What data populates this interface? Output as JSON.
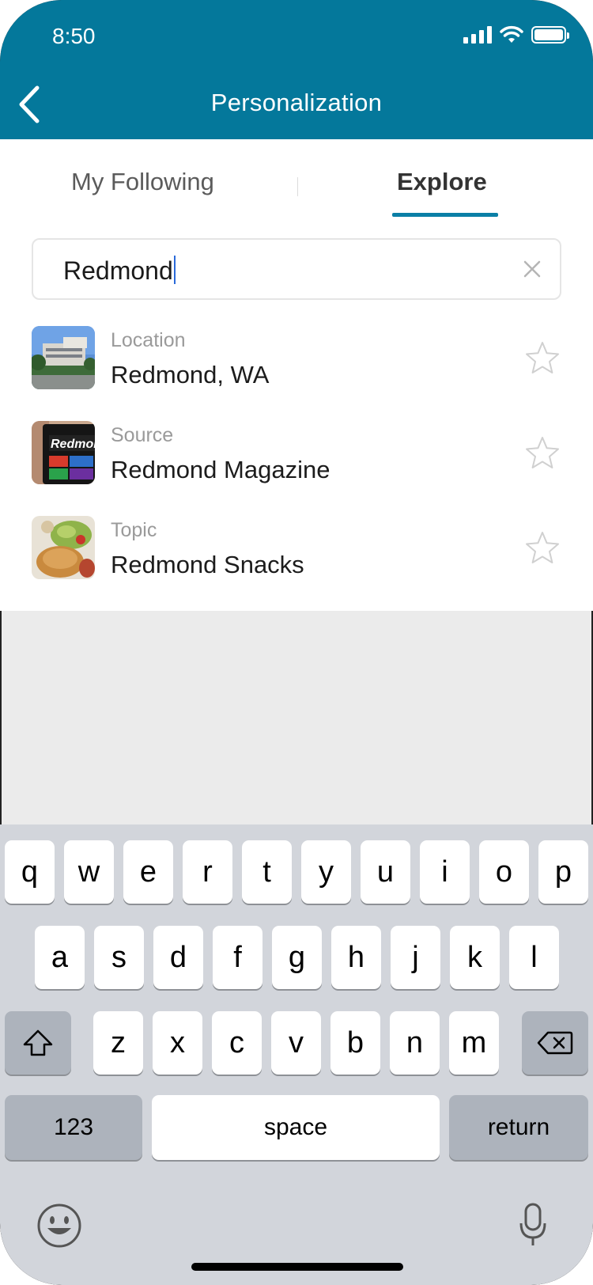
{
  "status_bar": {
    "time": "8:50"
  },
  "header": {
    "title": "Personalization"
  },
  "tabs": [
    {
      "label": "My Following",
      "active": false
    },
    {
      "label": "Explore",
      "active": true
    }
  ],
  "search": {
    "value": "Redmond"
  },
  "results": [
    {
      "category": "Location",
      "name": "Redmond, WA",
      "thumb": "building-photo"
    },
    {
      "category": "Source",
      "name": "Redmond Magazine",
      "thumb": "magazine-cover"
    },
    {
      "category": "Topic",
      "name": "Redmond Snacks",
      "thumb": "food-photo"
    }
  ],
  "keyboard": {
    "row1": [
      "q",
      "w",
      "e",
      "r",
      "t",
      "y",
      "u",
      "i",
      "o",
      "p"
    ],
    "row2": [
      "a",
      "s",
      "d",
      "f",
      "g",
      "h",
      "j",
      "k",
      "l"
    ],
    "row3": [
      "z",
      "x",
      "c",
      "v",
      "b",
      "n",
      "m"
    ],
    "numbers_label": "123",
    "space_label": "space",
    "return_label": "return"
  },
  "colors": {
    "header": "#04789b",
    "accent": "#0b7fa6",
    "keyboard_bg": "#d2d5db"
  }
}
